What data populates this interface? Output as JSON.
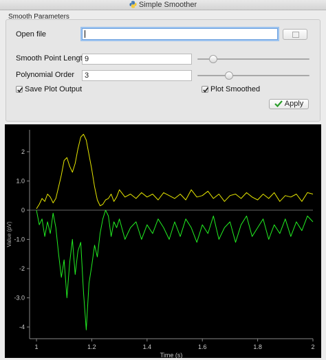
{
  "window": {
    "title": "Simple Smoother"
  },
  "group": {
    "title": "Smooth Parameters"
  },
  "open_file": {
    "label": "Open file",
    "value": ""
  },
  "smooth_point_length": {
    "label": "Smooth Point Length",
    "value": "9",
    "slider_fraction": 0.14
  },
  "polynomial_order": {
    "label": "Polynomial Order",
    "value": "3",
    "slider_fraction": 0.28
  },
  "save_plot_output": {
    "label": "Save Plot Output",
    "checked": true
  },
  "plot_smoothed": {
    "label": "Plot Smoothed",
    "checked": true
  },
  "apply": {
    "label": "Apply"
  },
  "chart_data": {
    "type": "line",
    "xlabel": "Time (s)",
    "ylabel": "Value (pV)",
    "xlim": [
      0.975,
      2.0
    ],
    "ylim": [
      -4.4,
      2.75
    ],
    "x_ticks": [
      1,
      1.2,
      1.4,
      1.6,
      1.8,
      2
    ],
    "x_tick_labels": [
      "1",
      "1.2",
      "1.4",
      "1.6",
      "1.8",
      "2"
    ],
    "y_ticks": [
      2,
      1,
      0,
      -1,
      -2,
      -3,
      -4
    ],
    "y_tick_labels": [
      "2",
      "1.0",
      "0",
      "-1.0",
      "-2",
      "-3.0",
      "-4"
    ],
    "grid": false,
    "background": "#000000",
    "series": [
      {
        "color": "#e6e600",
        "x": [
          1.0,
          1.01,
          1.02,
          1.03,
          1.04,
          1.05,
          1.06,
          1.07,
          1.08,
          1.09,
          1.1,
          1.11,
          1.12,
          1.13,
          1.14,
          1.15,
          1.16,
          1.17,
          1.18,
          1.19,
          1.2,
          1.21,
          1.22,
          1.23,
          1.24,
          1.25,
          1.26,
          1.27,
          1.28,
          1.29,
          1.3,
          1.32,
          1.34,
          1.36,
          1.38,
          1.4,
          1.42,
          1.44,
          1.46,
          1.48,
          1.5,
          1.52,
          1.54,
          1.56,
          1.58,
          1.6,
          1.62,
          1.64,
          1.66,
          1.68,
          1.7,
          1.72,
          1.74,
          1.76,
          1.78,
          1.8,
          1.82,
          1.84,
          1.86,
          1.88,
          1.9,
          1.92,
          1.94,
          1.96,
          1.98,
          2.0
        ],
        "values": [
          0.05,
          0.2,
          0.4,
          0.3,
          0.55,
          0.45,
          0.25,
          0.4,
          0.8,
          1.2,
          1.7,
          1.8,
          1.5,
          1.3,
          1.6,
          2.1,
          2.5,
          2.6,
          2.4,
          1.9,
          1.4,
          0.8,
          0.35,
          0.15,
          0.2,
          0.35,
          0.4,
          0.55,
          0.3,
          0.45,
          0.7,
          0.45,
          0.55,
          0.4,
          0.6,
          0.45,
          0.55,
          0.35,
          0.6,
          0.5,
          0.4,
          0.55,
          0.35,
          0.7,
          0.45,
          0.5,
          0.65,
          0.4,
          0.55,
          0.3,
          0.5,
          0.55,
          0.4,
          0.6,
          0.45,
          0.35,
          0.55,
          0.4,
          0.6,
          0.3,
          0.5,
          0.45,
          0.55,
          0.3,
          0.6,
          0.55
        ]
      },
      {
        "color": "#22ee22",
        "x": [
          1.0,
          1.01,
          1.02,
          1.03,
          1.04,
          1.05,
          1.06,
          1.07,
          1.08,
          1.09,
          1.1,
          1.11,
          1.12,
          1.13,
          1.14,
          1.15,
          1.16,
          1.17,
          1.18,
          1.19,
          1.2,
          1.21,
          1.22,
          1.23,
          1.24,
          1.25,
          1.26,
          1.27,
          1.28,
          1.29,
          1.3,
          1.32,
          1.34,
          1.36,
          1.38,
          1.4,
          1.42,
          1.44,
          1.46,
          1.48,
          1.5,
          1.52,
          1.54,
          1.56,
          1.58,
          1.6,
          1.62,
          1.64,
          1.66,
          1.68,
          1.7,
          1.72,
          1.74,
          1.76,
          1.78,
          1.8,
          1.82,
          1.84,
          1.86,
          1.88,
          1.9,
          1.92,
          1.94,
          1.96,
          1.98,
          2.0
        ],
        "values": [
          0.0,
          -0.5,
          -0.3,
          -0.9,
          -0.4,
          -0.8,
          -0.1,
          -0.6,
          -1.5,
          -2.3,
          -1.7,
          -3.0,
          -1.8,
          -1.0,
          -2.2,
          -1.4,
          -1.1,
          -2.8,
          -4.1,
          -2.5,
          -1.9,
          -1.2,
          -1.6,
          -0.8,
          -0.3,
          0.0,
          -0.2,
          -0.9,
          -0.4,
          -0.6,
          -0.3,
          -1.0,
          -0.6,
          -0.4,
          -1.0,
          -0.5,
          -0.8,
          -0.3,
          -0.6,
          -1.0,
          -0.4,
          -0.9,
          -0.3,
          -0.6,
          -1.1,
          -0.5,
          -0.8,
          -0.2,
          -1.0,
          -0.6,
          -0.4,
          -1.1,
          -0.5,
          -0.2,
          -0.9,
          -0.6,
          -0.3,
          -1.0,
          -0.5,
          -0.8,
          -0.3,
          -0.9,
          -0.4,
          -0.7,
          -0.2,
          -0.4
        ]
      }
    ]
  }
}
